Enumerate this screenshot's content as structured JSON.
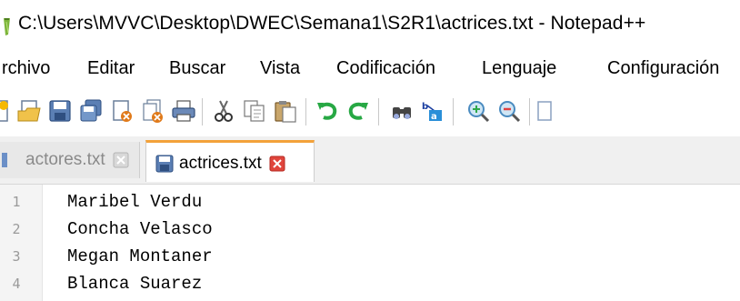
{
  "window": {
    "title": "C:\\Users\\MVVC\\Desktop\\DWEC\\Semana1\\S2R1\\actrices.txt - Notepad++"
  },
  "menu": {
    "items": [
      "rchivo",
      "Editar",
      "Buscar",
      "Vista",
      "Codificación",
      "Lenguaje",
      "Configuración"
    ]
  },
  "toolbar": {
    "buttons": [
      "new-file-icon",
      "open-file-icon",
      "save-icon",
      "save-all-icon",
      "close-icon",
      "close-all-icon",
      "print-icon",
      "cut-icon",
      "copy-icon",
      "paste-icon",
      "undo-icon",
      "redo-icon",
      "find-icon",
      "replace-icon",
      "zoom-in-icon",
      "zoom-out-icon"
    ]
  },
  "tabs": [
    {
      "label": "actores.txt",
      "active": false
    },
    {
      "label": "actrices.txt",
      "active": true
    }
  ],
  "editor": {
    "lines": [
      {
        "number": "1",
        "text": "Maribel Verdu"
      },
      {
        "number": "2",
        "text": "Concha Velasco"
      },
      {
        "number": "3",
        "text": "Megan Montaner"
      },
      {
        "number": "4",
        "text": "Blanca Suarez"
      }
    ]
  },
  "colors": {
    "active_tab_accent": "#f3a23a",
    "tab_close_red": "#e0453c",
    "gutter_bg": "#f4f4f4"
  }
}
